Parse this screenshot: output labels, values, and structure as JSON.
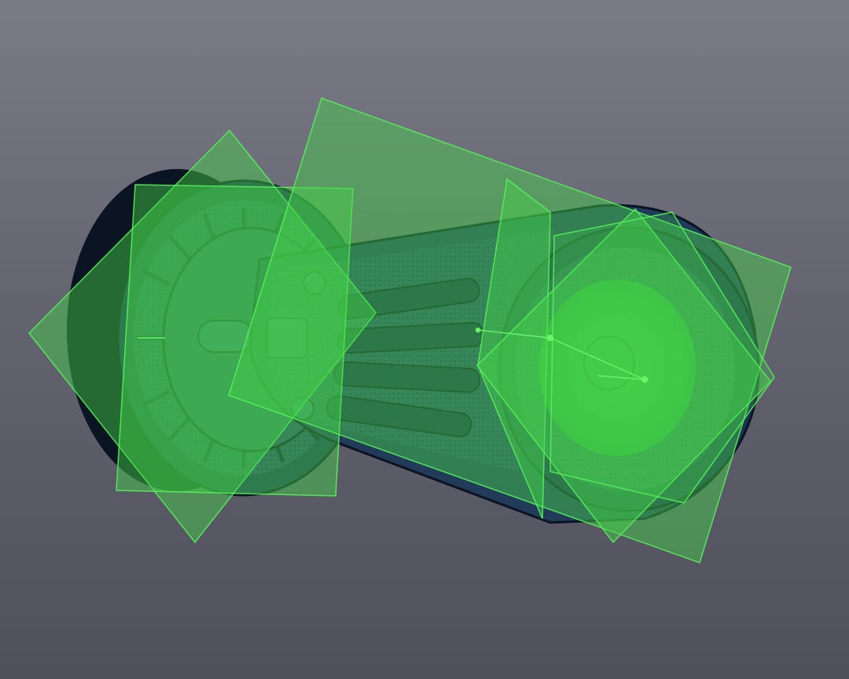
{
  "viewport": {
    "background_top": "#7a7b87",
    "background_bottom": "#4f505c"
  },
  "colors": {
    "mesh_dark": "#14233a",
    "mesh_mid": "#2a4767",
    "mesh_light": "#3d6286",
    "mesh_edge": "#0b1422",
    "plane_fill": "#45d34a",
    "plane_stroke": "#56ef5a",
    "selected_fill": "#46dc4b"
  },
  "scene": {
    "model": "belt-tensioner-scan-mesh",
    "clipping_planes_visible": true,
    "plane_count": 6
  }
}
